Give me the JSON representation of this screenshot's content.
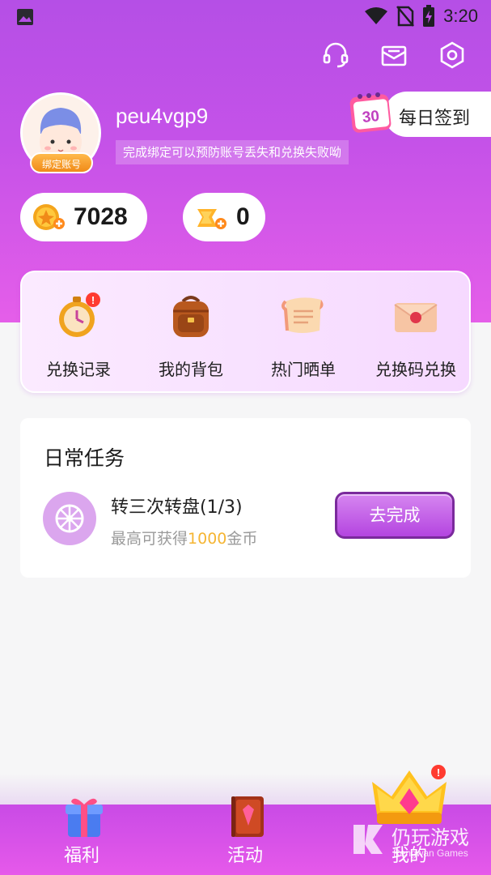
{
  "status_bar": {
    "time": "3:20",
    "icons": [
      "photo-icon",
      "wifi-icon",
      "no-sim-icon",
      "battery-icon"
    ]
  },
  "header": {
    "icons": [
      "headset-icon",
      "mail-icon",
      "settings-icon"
    ],
    "username": "peu4vgp9",
    "bind_badge": "绑定账号",
    "bind_tip": "完成绑定可以预防账号丢失和兑换失败呦",
    "checkin": {
      "calendar_day": "30",
      "label": "每日签到"
    }
  },
  "balances": [
    {
      "name": "coins",
      "icon": "gold-coin-icon",
      "value": "7028"
    },
    {
      "name": "vouchers",
      "icon": "voucher-icon",
      "value": "0"
    }
  ],
  "quick_menu": [
    {
      "label": "兑换记录",
      "icon": "stopwatch-icon"
    },
    {
      "label": "我的背包",
      "icon": "backpack-icon"
    },
    {
      "label": "热门晒单",
      "icon": "scroll-icon"
    },
    {
      "label": "兑换码兑换",
      "icon": "envelope-icon"
    }
  ],
  "daily_tasks": {
    "title": "日常任务",
    "task": {
      "name": "转三次转盘(1/3)",
      "desc_prefix": "最高可获得",
      "desc_amount": "1000",
      "desc_suffix": "金币",
      "button": "去完成",
      "icon": "wheel-icon"
    }
  },
  "bottom_nav": [
    {
      "label": "福利",
      "icon": "gift-icon"
    },
    {
      "label": "活动",
      "icon": "book-icon"
    },
    {
      "label": "我的",
      "icon": "crown-icon"
    }
  ],
  "watermark": {
    "text": "仍玩游戏",
    "sub": "Rengwan Games"
  },
  "colors": {
    "accent": "#c552e8",
    "gold": "#f5b533",
    "button_border": "#7a2a9c"
  }
}
